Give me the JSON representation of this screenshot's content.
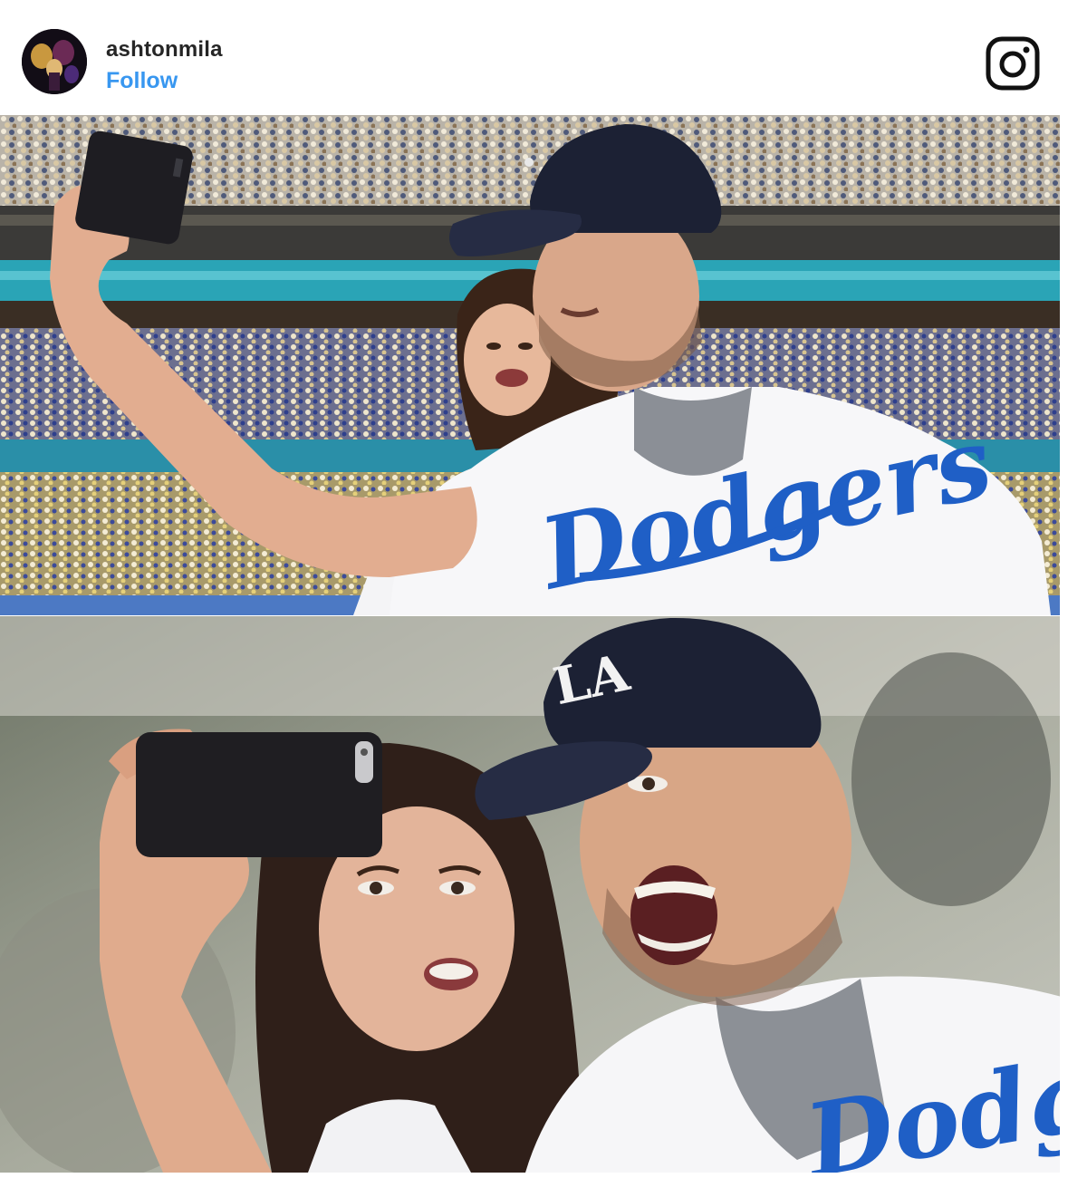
{
  "post": {
    "username": "ashtonmila",
    "follow_label": "Follow",
    "avatar_icon": "profile-avatar-icon",
    "platform_icon": "instagram-icon"
  },
  "photos": [
    {
      "jersey_text": "Dodgers"
    },
    {
      "cap_logo": "LA",
      "jersey_text": "Dodgers"
    }
  ],
  "colors": {
    "follow_link": "#3897f0",
    "username": "#262626",
    "dodger_blue": "#1f5fc6",
    "cap_navy": "#1c2134"
  }
}
